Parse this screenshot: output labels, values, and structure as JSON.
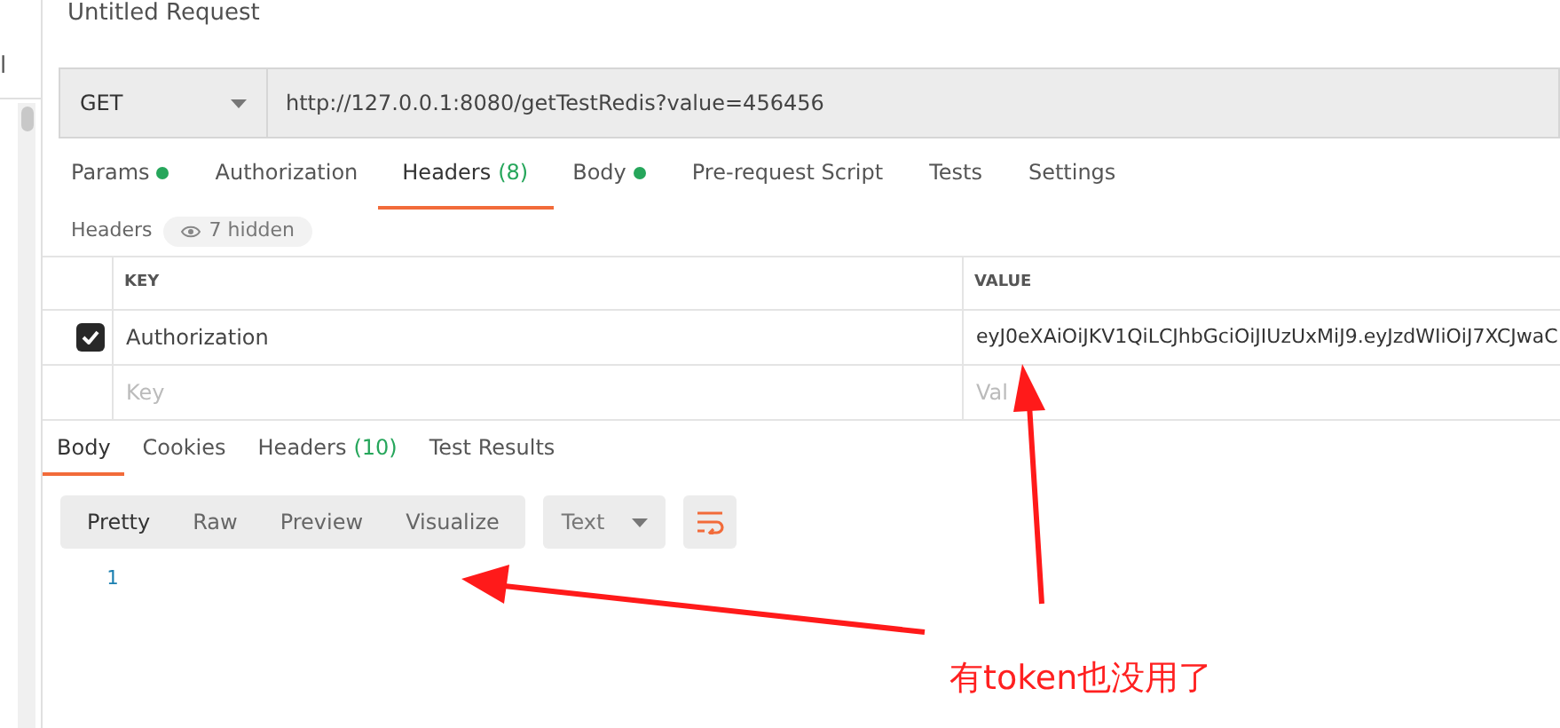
{
  "sidebar": {
    "text": "l"
  },
  "request": {
    "title": "Untitled Request",
    "method": "GET",
    "url": "http://127.0.0.1:8080/getTestRedis?value=456456"
  },
  "tabs": [
    {
      "label": "Params",
      "dot": true,
      "selected": false
    },
    {
      "label": "Authorization",
      "dot": false,
      "selected": false
    },
    {
      "label": "Headers",
      "count": "(8)",
      "dot": false,
      "selected": true
    },
    {
      "label": "Body",
      "dot": true,
      "selected": false
    },
    {
      "label": "Pre-request Script",
      "dot": false,
      "selected": false
    },
    {
      "label": "Tests",
      "dot": false,
      "selected": false
    },
    {
      "label": "Settings",
      "dot": false,
      "selected": false
    }
  ],
  "headers_bar": {
    "label": "Headers",
    "hidden": "7 hidden"
  },
  "table": {
    "columns": [
      "KEY",
      "VALUE"
    ],
    "rows": [
      {
        "checked": true,
        "key": "Authorization",
        "value": "eyJ0eXAiOiJKV1QiLCJhbGciOiJIUzUxMiJ9.eyJzdWIiOiJ7XCJwaC"
      }
    ],
    "new_row": {
      "key_placeholder": "Key",
      "value_placeholder": "Val"
    }
  },
  "response_tabs": [
    {
      "label": "Body",
      "selected": true
    },
    {
      "label": "Cookies",
      "selected": false
    },
    {
      "label": "Headers",
      "count": "(10)",
      "selected": false
    },
    {
      "label": "Test Results",
      "selected": false
    }
  ],
  "view_modes": [
    {
      "label": "Pretty",
      "selected": true
    },
    {
      "label": "Raw",
      "selected": false
    },
    {
      "label": "Preview",
      "selected": false
    },
    {
      "label": "Visualize",
      "selected": false
    }
  ],
  "format": "Text",
  "lines": [
    "1"
  ],
  "annotation": {
    "text": "有token也没用了"
  }
}
